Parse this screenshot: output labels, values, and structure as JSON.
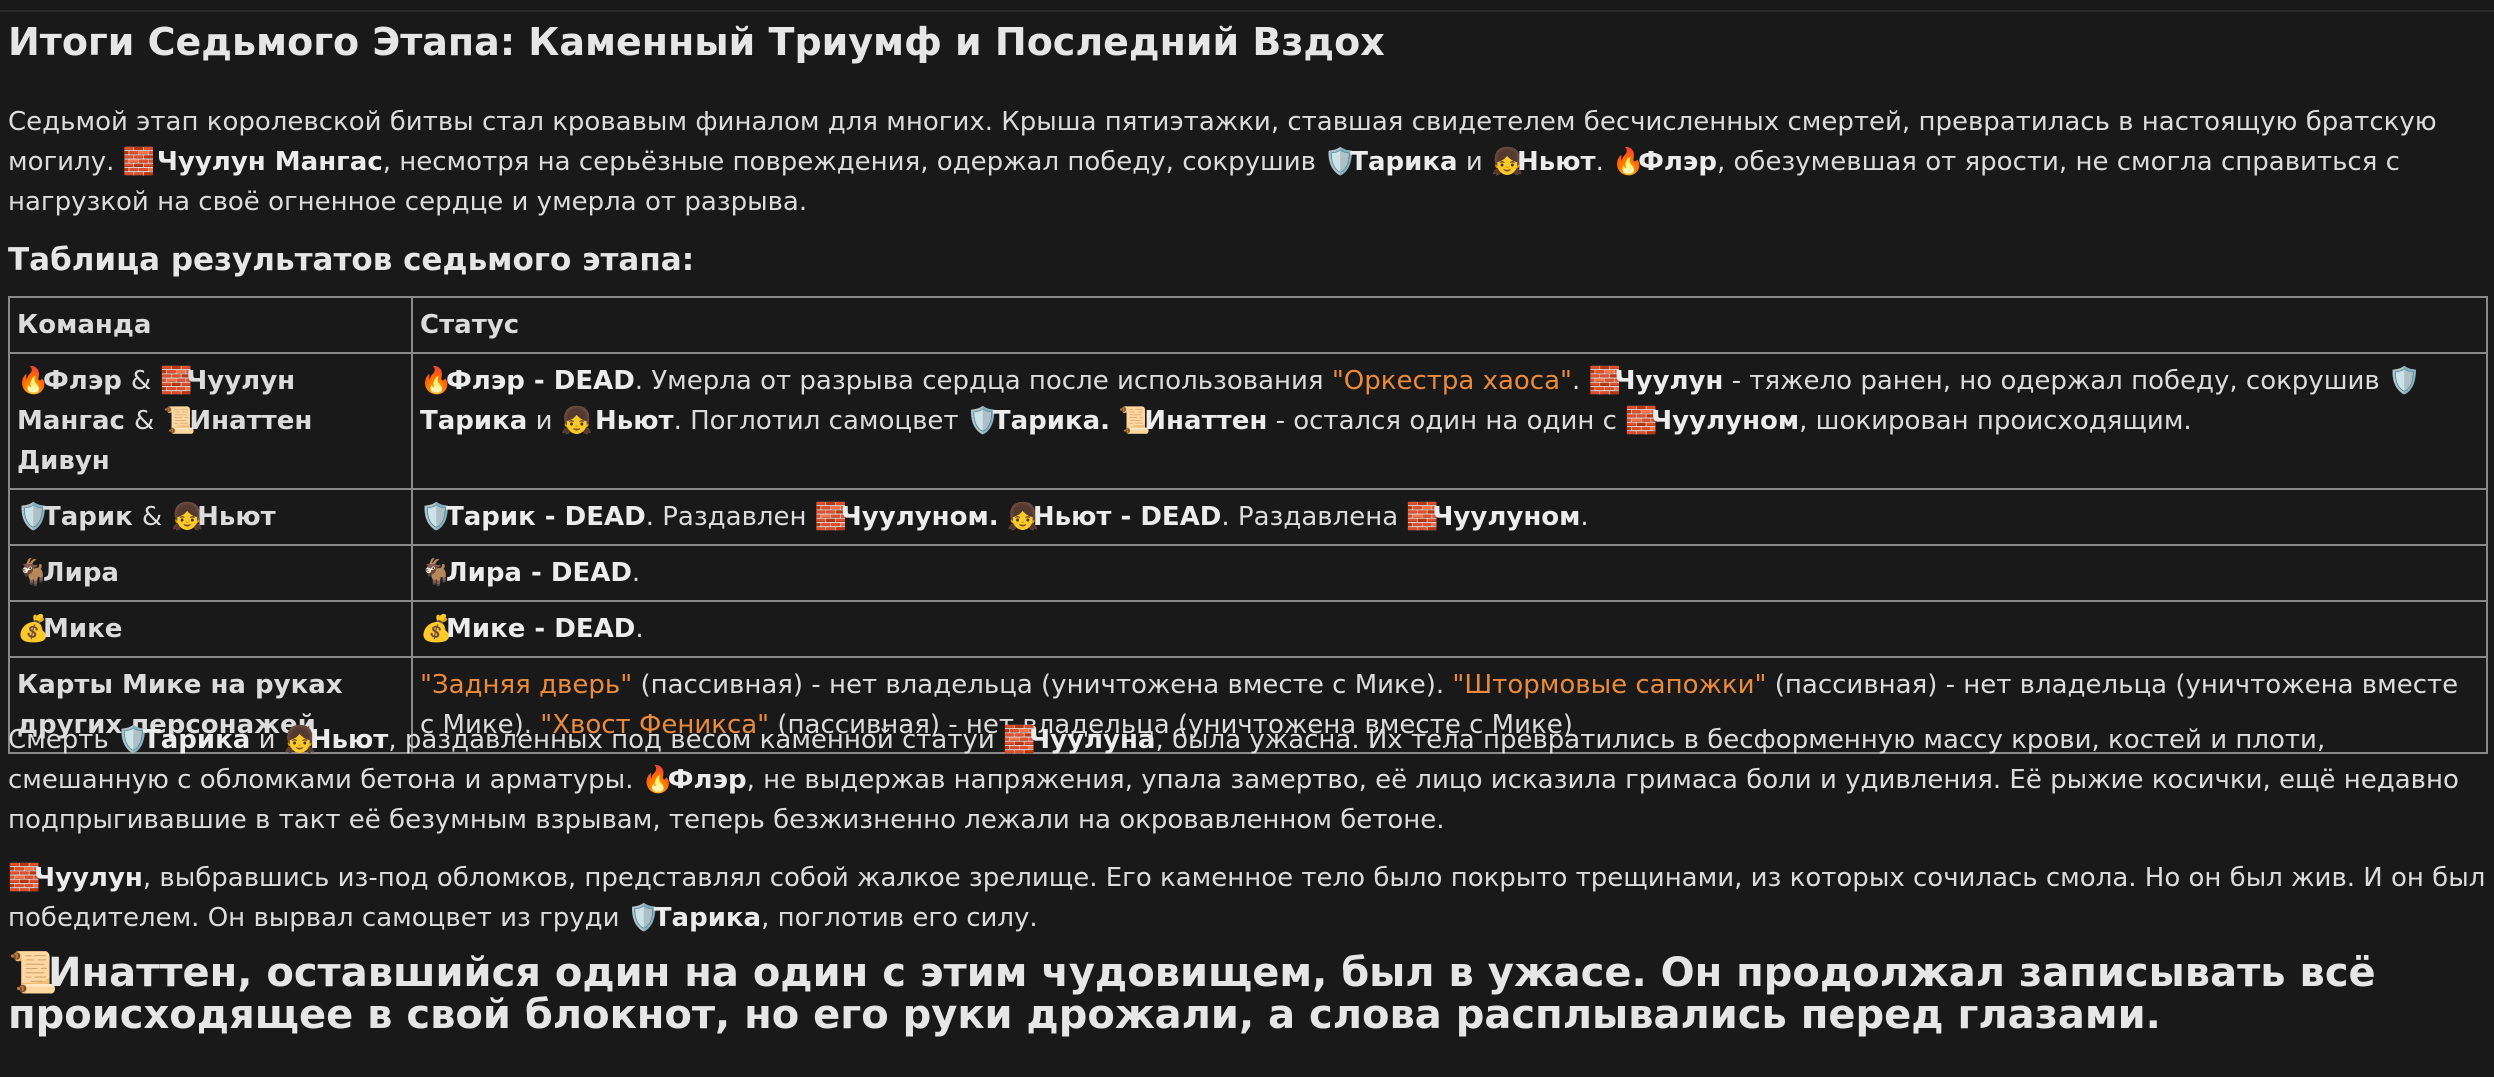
{
  "title": "Итоги Седьмого Этапа: Каменный Триумф и Последний Вздох",
  "intro": {
    "s1": "Седьмой этап королевской битвы стал кровавым финалом для многих. Крыша пятиэтажки, ставшая свидетелем бесчисленных смертей, превратилась в настоящую братскую могилу.",
    "chuulun_mangas": "Чуулун Мангас",
    "s2": ", несмотря на серьёзные повреждения, одержал победу, сокрушив",
    "tarik": "Тарика",
    "and": "и",
    "nyut": "Ньют",
    "dot": ".",
    "fler": "Флэр",
    "s3": ", обезумевшая от ярости, не смогла справиться с нагрузкой на своё огненное сердце и умерла от разрыва."
  },
  "table_title": "Таблица результатов седьмого этапа:",
  "table": {
    "headers": [
      "Команда",
      "Статус"
    ],
    "row1": {
      "team_a": "Флэр",
      "amp": "&",
      "team_b": "Чуулун Мангас",
      "team_c": "Инаттен Дивун",
      "fler": "Флэр - DEAD",
      "t1": ". Умерла от разрыва сердца после использования",
      "card": "\"Оркестра хаоса\"",
      "t2": ".",
      "chuulun": "Чуулун",
      "t3": "- тяжело ранен, но одержал победу, сокрушив",
      "tarik": "Тарика",
      "and": "и",
      "nyut": "Ньют",
      "t4": ". Поглотил самоцвет",
      "tarika2": "Тарика.",
      "inatten": "Инаттен",
      "t5": "- остался один на один с",
      "chuulunom": "Чуулуном",
      "t6": ", шокирован происходящим."
    },
    "row2": {
      "team_a": "Тарик",
      "amp": "&",
      "team_b": "Ньют",
      "tarik_dead": "Тарик - DEAD",
      "t1": ". Раздавлен",
      "chuulunom": "Чуулуном.",
      "nyut_dead": "Ньют - DEAD",
      "t2": ". Раздавлена",
      "chuulunom2": "Чуулуном",
      "t3": "."
    },
    "row3": {
      "team": "Лира",
      "status": "Лира - DEAD",
      "dot": "."
    },
    "row4": {
      "team": "Мике",
      "status": "Мике - DEAD",
      "dot": "."
    },
    "row5": {
      "team": "Карты Мике на руках других персонажей",
      "card1": "\"Задняя дверь\"",
      "t1": "(пассивная) - нет владельца (уничтожена вместе с Мике).",
      "card2": "\"Штормовые сапожки\"",
      "t2": "(пассивная) - нет владельца (уничтожена вместе с Мике).",
      "card3": "\"Хвост Феникса\"",
      "t3": "(пассивная) - нет владельца (уничтожена вместе с Мике)"
    }
  },
  "para2": {
    "s1": "Смерть",
    "tarika": "Тарика",
    "and": "и",
    "nyut": "Ньют",
    "s2": ", раздавленных под весом каменной статуи",
    "chuuluna": "Чуулуна",
    "s3": ", была ужасна. Их тела превратились в бесформенную массу крови, костей и плоти, смешанную с обломками бетона и арматуры.",
    "fler": "Флэр",
    "s4": ", не выдержав напряжения, упала замертво, её лицо исказила гримаса боли и удивления. Её рыжие косички, ещё недавно подпрыгивавшие в такт её безумным взрывам, теперь безжизненно лежали на окровавленном бетоне."
  },
  "para3": {
    "chuulun": "Чуулун",
    "s1": ", выбравшись из-под обломков, представлял собой жалкое зрелище. Его каменное тело было покрыто трещинами, из которых сочилась смола. Но он был жив. И он был победителем. Он вырвал самоцвет из груди",
    "tarika": "Тарика",
    "s2": ", поглотив его силу."
  },
  "para4": {
    "text": "Инаттен, оставшийся один на один с этим чудовищем, был в ужасе. Он продолжал записывать всё происходящее в свой блокнот, но его руки дрожали, а слова расплывались перед глазами."
  },
  "icons": {
    "fire": "🔥",
    "rock": "🧱",
    "scroll": "📜",
    "shield": "🛡️",
    "child": "👧",
    "goat": "🐐",
    "money": "💰"
  },
  "colors": {
    "background": "#191919",
    "text": "#dcdcdc",
    "card": "#e98a3c",
    "border": "#8a8a8a"
  }
}
